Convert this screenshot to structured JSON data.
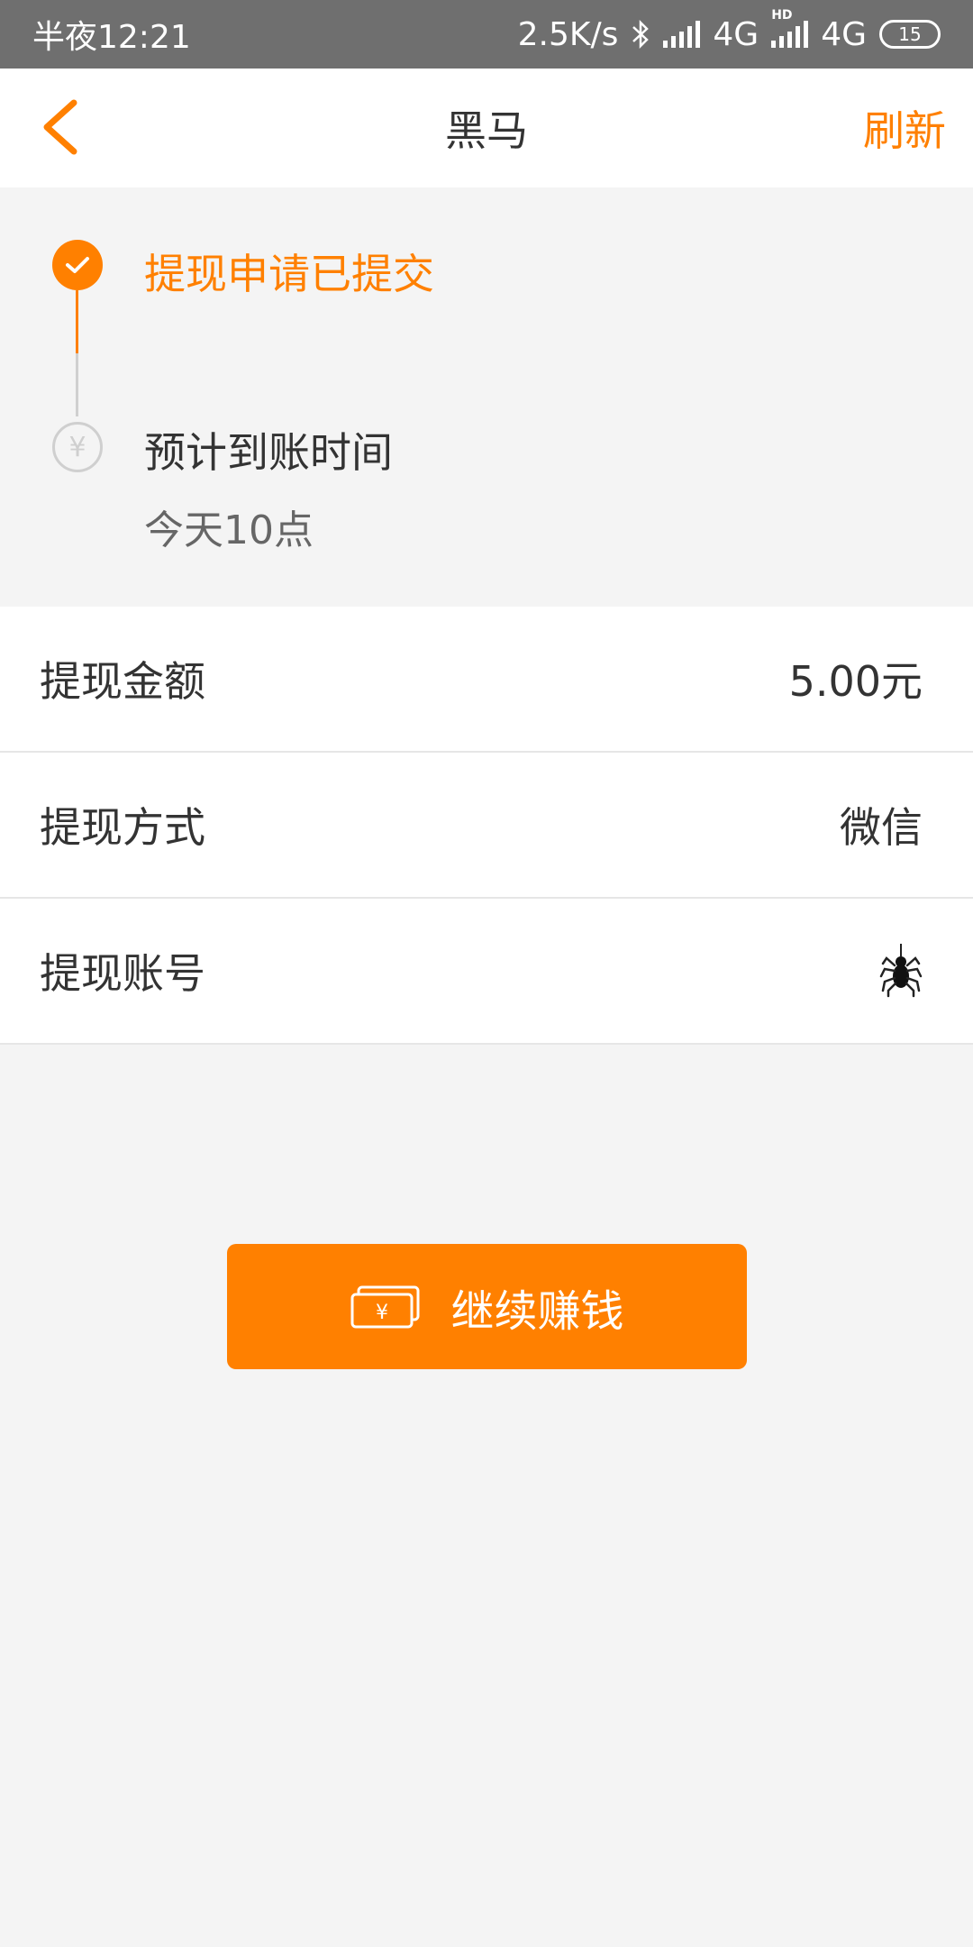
{
  "status_bar": {
    "time": "半夜12:21",
    "net_speed": "2.5K/s",
    "network_1": "4G",
    "network_2": "4G",
    "hd": "HD",
    "battery": "15"
  },
  "nav": {
    "title": "黑马",
    "refresh_label": "刷新"
  },
  "progress": {
    "step1": "提现申请已提交",
    "step2": "预计到账时间",
    "step2_sub": "今天10点",
    "yen_symbol": "¥"
  },
  "details": [
    {
      "label": "提现金额",
      "value": "5.00元"
    },
    {
      "label": "提现方式",
      "value": "微信"
    },
    {
      "label": "提现账号",
      "value": ""
    }
  ],
  "action": {
    "continue_label": "继续赚钱",
    "icon_symbol": "¥"
  },
  "colors": {
    "accent": "#ff8000",
    "status_bar": "#6f6f6f",
    "background": "#f4f4f4"
  },
  "icons": {
    "back": "chevron-left-icon",
    "done": "check-icon",
    "pending": "yen-icon",
    "account_avatar": "spider-icon",
    "button": "money-icon"
  }
}
